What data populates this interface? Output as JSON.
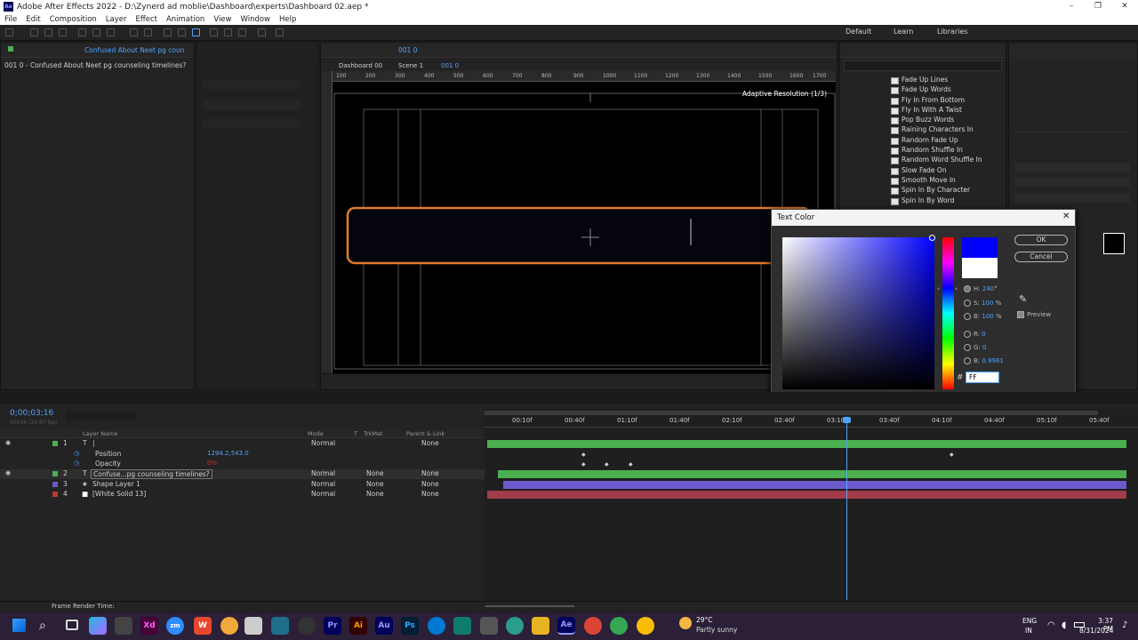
{
  "window": {
    "title": "Adobe After Effects 2022 - D:\\Zynerd ad moblie\\Dashboard\\experts\\Dashboard 02.aep *"
  },
  "menu": [
    "File",
    "Edit",
    "Composition",
    "Layer",
    "Effect",
    "Animation",
    "View",
    "Window",
    "Help"
  ],
  "workspaces": [
    "Default",
    "Learn",
    "Libraries"
  ],
  "project_panel": {
    "tab": "Confused About Neet pg coun",
    "item": "001 0 - Confused About Neet pg counseling timelines?"
  },
  "comp_panel": {
    "tab": "001 0",
    "breadcrumbs": [
      "Dashboard 00",
      "Scene 1",
      "001 0"
    ],
    "resolution_label": "Adaptive Resolution (1/3)",
    "ruler": [
      "100",
      "200",
      "300",
      "400",
      "500",
      "600",
      "700",
      "800",
      "900",
      "1000",
      "1100",
      "1200",
      "1300",
      "1400",
      "1500",
      "1600",
      "1700"
    ]
  },
  "effects_list": [
    "Fade Up Lines",
    "Fade Up Words",
    "Fly In From Bottom",
    "Fly In With A Twist",
    "Pop Buzz Words",
    "Raining Characters In",
    "Random Fade Up",
    "Random Shuffle In",
    "Random Word Shuffle In",
    "Slow Fade On",
    "Smooth Move In",
    "Spin In By Character",
    "Spin In By Word"
  ],
  "color_dialog": {
    "title": "Text Color",
    "ok": "OK",
    "cancel": "Cancel",
    "preview": "Preview",
    "h": "240",
    "h_unit": "°",
    "s": "100",
    "s_unit": "%",
    "b": "100",
    "b_unit": "%",
    "r": "0",
    "g": "0",
    "bl": "0.9961",
    "hex": "FF",
    "new_color": "#0000ff",
    "old_color": "#ffffff"
  },
  "timeline": {
    "timecode": "0;00;03;16",
    "timecode_sub": "00106 (29.97 fps)",
    "columns": {
      "name": "Layer Name",
      "mode": "Mode",
      "t": "T",
      "trkmat": "TrkMat",
      "parent": "Parent & Link"
    },
    "layers": [
      {
        "num": "1",
        "type": "T",
        "name": "|",
        "mode": "Normal",
        "trkmat": "",
        "parent": "None",
        "color": "#4caf50"
      },
      {
        "num": "2",
        "type": "T",
        "name": "Confuse...pg counseling timelines?",
        "mode": "Normal",
        "trkmat": "None",
        "parent": "None",
        "color": "#4caf50"
      },
      {
        "num": "3",
        "type": "★",
        "name": "Shape Layer 1",
        "mode": "Normal",
        "trkmat": "None",
        "parent": "None",
        "color": "#6a5acd"
      },
      {
        "num": "4",
        "type": "■",
        "name": "[White Solid 13]",
        "mode": "Normal",
        "trkmat": "None",
        "parent": "None",
        "color": "#c0392b"
      }
    ],
    "props": [
      {
        "name": "Position",
        "value": "1294.2,543.0"
      },
      {
        "name": "Opacity",
        "value": "0%"
      }
    ],
    "ticks": [
      "00:10f",
      "00:40f",
      "01:10f",
      "01:40f",
      "02:10f",
      "02:40f",
      "03:10f",
      "03:40f",
      "04:10f",
      "04:40f",
      "05:10f",
      "05:40f"
    ],
    "footer": "Frame Render Time:"
  },
  "taskbar": {
    "weather_temp": "29°C",
    "weather_desc": "Partly sunny",
    "lang": "ENG",
    "region": "IN",
    "time": "3:37 PM",
    "date": "8/31/2024",
    "apps": [
      "Xd",
      "zm",
      "W",
      "Pr",
      "Ai",
      "Au",
      "Ps",
      "Ae"
    ]
  }
}
